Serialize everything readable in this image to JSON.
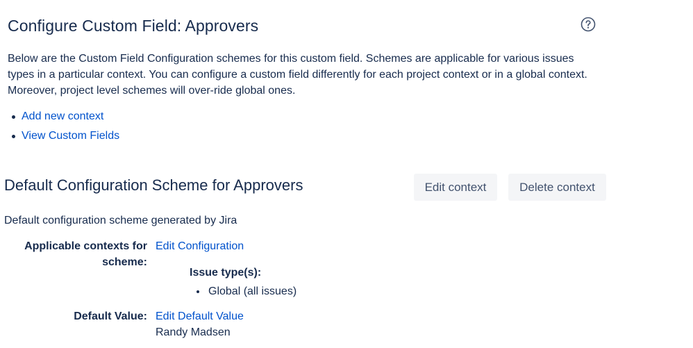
{
  "header": {
    "title": "Configure Custom Field: Approvers",
    "help_icon": "question-circle-icon"
  },
  "description": "Below are the Custom Field Configuration schemes for this custom field. Schemes are applicable for various issues types in a particular context. You can configure a custom field differently for each project context or in a global context. Moreover, project level schemes will over-ride global ones.",
  "links": {
    "add_context": "Add new context",
    "view_fields": "View Custom Fields"
  },
  "scheme": {
    "title": "Default Configuration Scheme for Approvers",
    "edit_button": "Edit context",
    "delete_button": "Delete context",
    "description": "Default configuration scheme generated by Jira",
    "contexts_label": "Applicable contexts for scheme:",
    "edit_configuration": "Edit Configuration",
    "issue_types_heading": "Issue type(s):",
    "issue_types": [
      "Global (all issues)"
    ],
    "default_value_label": "Default Value:",
    "edit_default_value": "Edit Default Value",
    "default_value": "Randy Madsen"
  },
  "colors": {
    "text": "#172b4d",
    "link": "#0052cc",
    "button_bg": "#f4f5f7",
    "button_text": "#42526e"
  }
}
